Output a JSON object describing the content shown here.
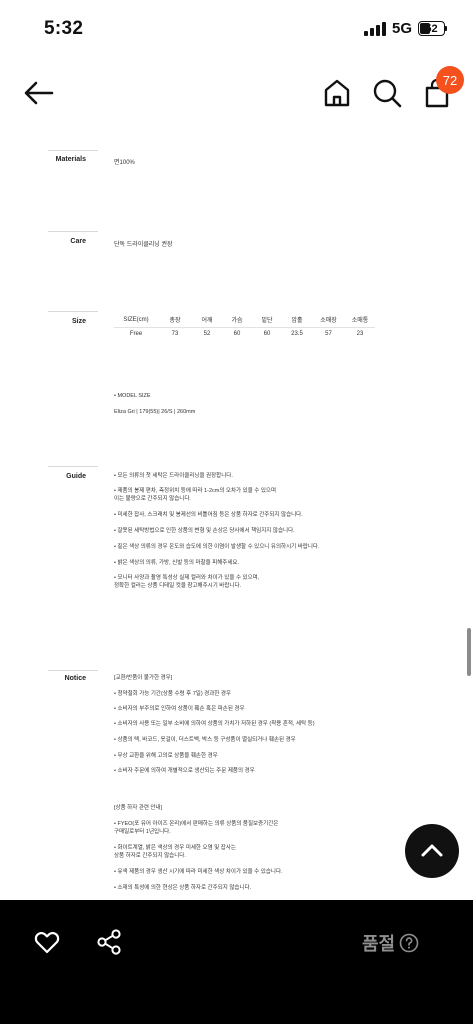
{
  "status_bar": {
    "time": "5:32",
    "network": "5G",
    "battery": "52"
  },
  "header": {
    "cart_count": "72"
  },
  "materials": {
    "label": "Materials",
    "value": "면100%"
  },
  "care": {
    "label": "Care",
    "value": "단독 드라이클리닝 권장"
  },
  "size": {
    "label": "Size",
    "headers": [
      "SIZE(cm)",
      "총장",
      "어깨",
      "가슴",
      "밑단",
      "암홀",
      "소매장",
      "소매통"
    ],
    "rows": [
      [
        "Free",
        "73",
        "52",
        "60",
        "60",
        "23.5",
        "57",
        "23"
      ]
    ]
  },
  "model": {
    "title": "• MODEL SIZE",
    "info": "Eliza Gri | 179(55)| 26/S | 260mm"
  },
  "guide": {
    "label": "Guide",
    "lines": [
      "• 모든 의류의 첫 세탁은 드라이클리닝을 권장합니다.",
      "• 제품의 봉제 편차, 측정위치 등에 따라 1-2cm의 오차가 있을 수 있으며",
      "  이는 불량으로 간주되지 않습니다.",
      "• 미세한 잡사, 스크래치 및 봉제선의 비틀어짐 등은 상품 하자로 간주되지 않습니다.",
      "• 잘못된 세탁방법으로 인한 상품의 변형 및 손상은 당사에서 책임지지 않습니다.",
      "• 짙은 색상 의류의 경우 온도와 습도에 의한 이염이 발생할 수 있으니 유의하시기 바랍니다.",
      "• 밝은 색상의 의류, 가방, 신발 등의 마찰을 피해주세요.",
      "• 모니터 사양과 촬영 특성상 실제 컬러와 차이가 있을 수 있으며,",
      "  정확한 컬러는 상품 디테일 컷을 참고해주시기 바랍니다."
    ]
  },
  "notice": {
    "label": "Notice",
    "lines": [
      "[교환/반품이 불가한 경우]",
      "• 청약철회 가능 기간(상품 수령 후 7일) 경과한 경우",
      "• 소비자의 부주의로 인하여 상품이 훼손 혹은 파손된 경우",
      "• 소비자의 사용 또는 일부 소비에 의하여 상품의 가치가 저하된 경우 (착용 흔적, 세탁 등)",
      "• 상품의 택, 바코드, 옷걸이, 더스트백, 박스 등 구성품이 멸실되거나 훼손된 경우",
      "• 무상 교환을 위해 고의로 상품을 훼손한 경우",
      "• 소비자 주문에 의하여 개별적으로 생산되는 주문 제품의 경우",
      "[상품 하자 관련 안내]",
      "• FYEO(포 유어 아이즈 온리)에서 판매하는 의류 상품의 품질보증기간은",
      "  구매일로부터 1년입니다.",
      "• 화이트계열, 밝은 색상의 경우 미세한 오염 및 잡사는",
      "  상품 하자로 간주되지 않습니다.",
      "• 유색 제품의 경우 생산 시기에 따라 미세한 색상 차이가 있을 수 있습니다.",
      "• 소재의 특성에 의한 현상은 상품 하자로 간주되지 않습니다."
    ]
  },
  "bottom_bar": {
    "soldout_label": "품절"
  }
}
